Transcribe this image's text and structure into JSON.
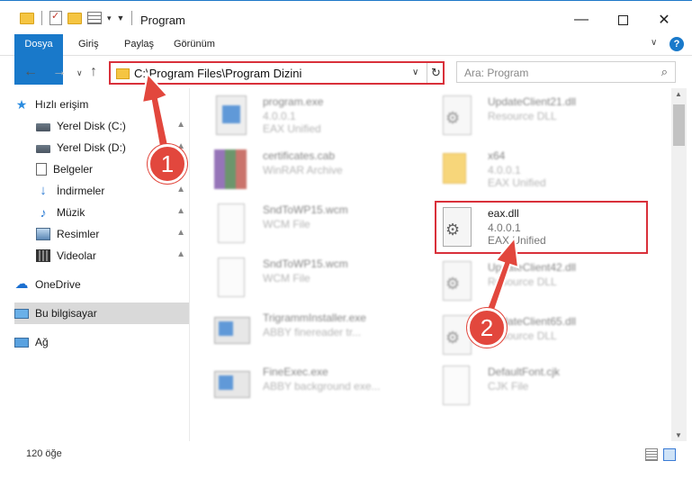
{
  "window": {
    "title": "Program",
    "minimize": "—",
    "close": "✕"
  },
  "ribbon": {
    "tabs": [
      "Dosya",
      "Giriş",
      "Paylaş",
      "Görünüm"
    ],
    "expand": "∨",
    "help": "?"
  },
  "address": {
    "path": "C:\\Program Files\\Program Dizini",
    "dropdown": "∨",
    "refresh": "↻"
  },
  "nav": {
    "back": "←",
    "forward": "→",
    "recent": "∨",
    "up": "↑"
  },
  "search": {
    "placeholder": "Ara: Program",
    "icon": "⌕"
  },
  "sidebar": {
    "items": [
      {
        "label": "Hızlı erişim",
        "icon": "star-icon"
      },
      {
        "label": "Yerel Disk (C:)",
        "icon": "disk-icon",
        "pinned": true
      },
      {
        "label": "Yerel Disk (D:)",
        "icon": "disk-icon",
        "pinned": true
      },
      {
        "label": "Belgeler",
        "icon": "documents-icon",
        "pinned": true
      },
      {
        "label": "İndirmeler",
        "icon": "download-icon",
        "pinned": true
      },
      {
        "label": "Müzik",
        "icon": "music-icon",
        "pinned": true
      },
      {
        "label": "Resimler",
        "icon": "pictures-icon",
        "pinned": true
      },
      {
        "label": "Videolar",
        "icon": "video-icon",
        "pinned": true
      },
      {
        "label": "OneDrive",
        "icon": "cloud-icon"
      },
      {
        "label": "Bu bilgisayar",
        "icon": "computer-icon",
        "selected": true
      },
      {
        "label": "Ağ",
        "icon": "network-icon"
      }
    ],
    "pin_glyph": "▲"
  },
  "files": [
    {
      "name": "program.exe",
      "line2": "4.0.0.1",
      "line3": "EAX Unified",
      "type": "exe"
    },
    {
      "name": "UpdateClient21.dll",
      "line2": "Resource DLL",
      "line3": "",
      "type": "dll"
    },
    {
      "name": "certificates.cab",
      "line2": "WinRAR Archive",
      "line3": "",
      "type": "rar"
    },
    {
      "name": "x64",
      "line2": "4.0.0.1",
      "line3": "EAX Unified",
      "type": "folder"
    },
    {
      "name": "SndToWP15.wcm",
      "line2": "WCM File",
      "line3": "",
      "type": "doc"
    },
    {
      "name": "eax.dll",
      "line2": "4.0.0.1",
      "line3": "EAX Unified",
      "type": "dll"
    },
    {
      "name": "SndToWP15.wcm",
      "line2": "WCM File",
      "line3": "",
      "type": "doc"
    },
    {
      "name": "UpdateClient42.dll",
      "line2": "Resource DLL",
      "line3": "",
      "type": "dll"
    },
    {
      "name": "TrigrammInstaller.exe",
      "line2": "ABBY finereader tr...",
      "line3": "",
      "type": "app"
    },
    {
      "name": "UpdateClient65.dll",
      "line2": "Resource DLL",
      "line3": "",
      "type": "dll"
    },
    {
      "name": "FineExec.exe",
      "line2": "ABBY background exe...",
      "line3": "",
      "type": "app"
    },
    {
      "name": "DefaultFont.cjk",
      "line2": "CJK File",
      "line3": "",
      "type": "doc"
    }
  ],
  "status": {
    "item_count": "120 öğe"
  },
  "annotations": {
    "step1": "1",
    "step2": "2",
    "color": "#e2473d"
  },
  "colors": {
    "accent": "#1979ca",
    "highlight_border": "#d9303a"
  }
}
